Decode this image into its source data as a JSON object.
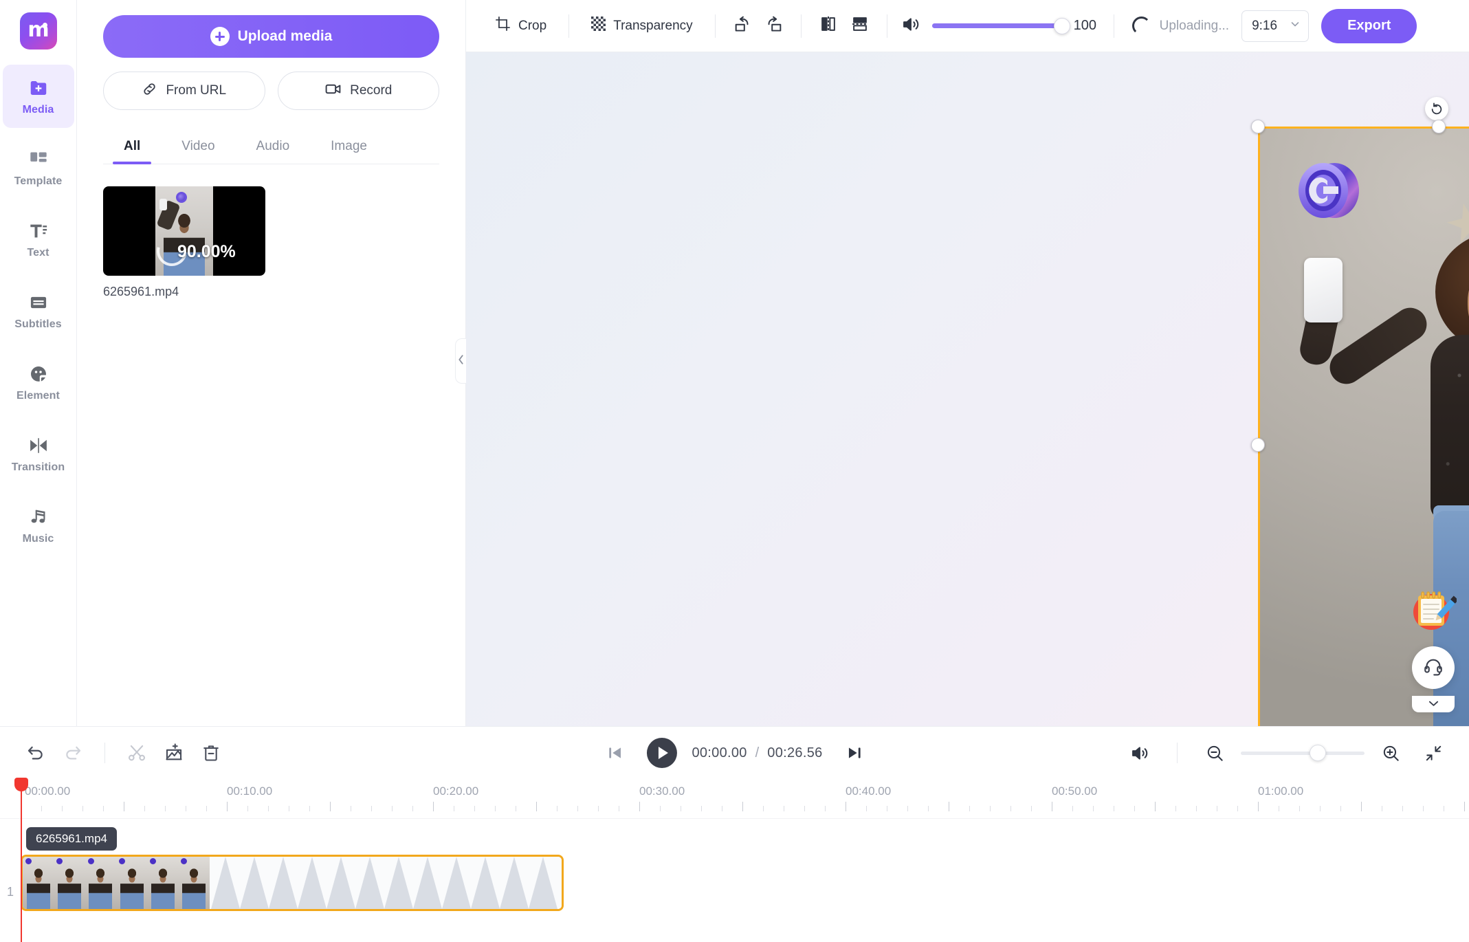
{
  "brand": {
    "logo_letter": "m",
    "accent": "#7c5cf5",
    "selection": "#f2a81c",
    "playhead": "#f1372f"
  },
  "rail": {
    "items": [
      {
        "label": "Media",
        "icon": "media-folder-icon",
        "active": true
      },
      {
        "label": "Template",
        "icon": "template-grid-icon",
        "active": false
      },
      {
        "label": "Text",
        "icon": "text-icon",
        "active": false
      },
      {
        "label": "Subtitles",
        "icon": "subtitles-icon",
        "active": false
      },
      {
        "label": "Element",
        "icon": "element-sticker-icon",
        "active": false
      },
      {
        "label": "Transition",
        "icon": "transition-icon",
        "active": false
      },
      {
        "label": "Music",
        "icon": "music-note-icon",
        "active": false
      }
    ]
  },
  "panel": {
    "upload_label": "Upload media",
    "from_url_label": "From URL",
    "record_label": "Record",
    "tabs": [
      {
        "label": "All",
        "active": true
      },
      {
        "label": "Video",
        "active": false
      },
      {
        "label": "Audio",
        "active": false
      },
      {
        "label": "Image",
        "active": false
      }
    ],
    "media": [
      {
        "name": "6265961.mp4",
        "progress": "90.00%"
      }
    ],
    "collapse_icon": "chevron-left-icon"
  },
  "toolbar": {
    "crop_label": "Crop",
    "transparency_label": "Transparency",
    "rotate_left_icon": "rotate-left-icon",
    "rotate_right_icon": "rotate-right-icon",
    "flip_horizontal_icon": "flip-horizontal-icon",
    "flip_vertical_icon": "flip-vertical-icon",
    "volume_icon": "volume-icon",
    "volume_value": "100",
    "upload_status": "Uploading...",
    "aspect_ratio": "9:16",
    "export_label": "Export"
  },
  "canvas": {
    "watermark": "copyright-3d-logo",
    "rotate_handle_icon": "rotate-handle-icon"
  },
  "float": {
    "survey_icon": "notepad-pencil-icon",
    "support_icon": "headset-icon",
    "collapse_icon": "chevron-down-icon"
  },
  "timeline": {
    "undo_icon": "undo-icon",
    "redo_icon": "redo-icon",
    "split_icon": "scissors-split-icon",
    "add_media_icon": "add-image-icon",
    "delete_icon": "trash-icon",
    "skip_start_icon": "skip-to-start-icon",
    "play_icon": "play-icon",
    "skip_end_icon": "skip-to-end-icon",
    "current_time": "00:00.00",
    "time_separator": "/",
    "total_time": "00:26.56",
    "mute_icon": "volume-icon",
    "zoom_out_icon": "zoom-out-icon",
    "zoom_in_icon": "zoom-in-icon",
    "fit_icon": "fit-screen-icon",
    "ruler_labels": [
      "00:00.00",
      "00:10.00",
      "00:20.00",
      "00:30.00",
      "00:40.00",
      "00:50.00",
      "01:00.00"
    ],
    "track_number": "1",
    "clip": {
      "name": "6265961.mp4"
    }
  }
}
